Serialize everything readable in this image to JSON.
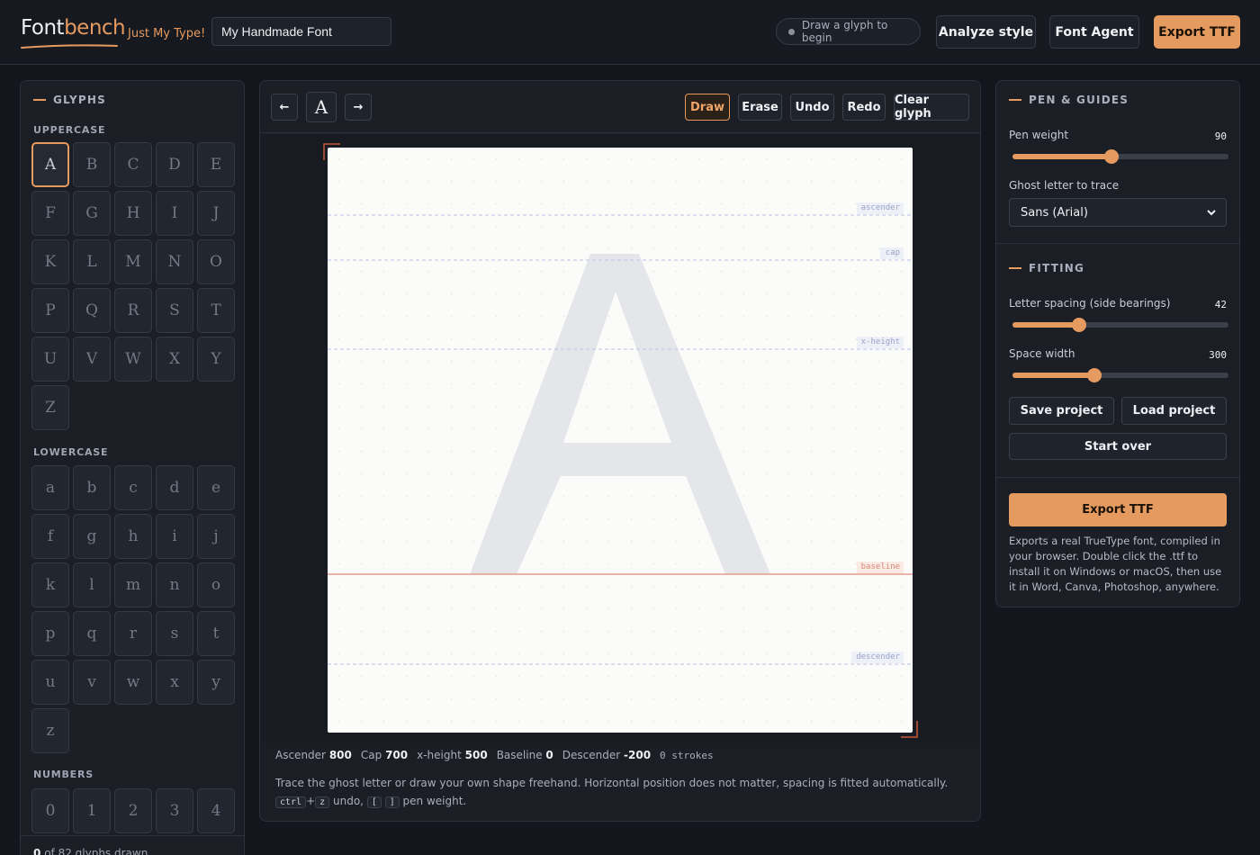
{
  "header": {
    "logo_main": "Font",
    "logo_accent": "bench",
    "tagline": "Just My Type!",
    "font_name_value": "My Handmade Font",
    "status": "Draw a glyph to begin",
    "analyze_label": "Analyze style",
    "agent_label": "Font Agent",
    "export_label": "Export TTF"
  },
  "glyphs": {
    "title": "GLYPHS",
    "uppercase_label": "UPPERCASE",
    "uppercase": [
      "A",
      "B",
      "C",
      "D",
      "E",
      "F",
      "G",
      "H",
      "I",
      "J",
      "K",
      "L",
      "M",
      "N",
      "O",
      "P",
      "Q",
      "R",
      "S",
      "T",
      "U",
      "V",
      "W",
      "X",
      "Y",
      "Z"
    ],
    "lowercase_label": "LOWERCASE",
    "lowercase": [
      "a",
      "b",
      "c",
      "d",
      "e",
      "f",
      "g",
      "h",
      "i",
      "j",
      "k",
      "l",
      "m",
      "n",
      "o",
      "p",
      "q",
      "r",
      "s",
      "t",
      "u",
      "v",
      "w",
      "x",
      "y",
      "z"
    ],
    "numbers_label": "NUMBERS",
    "numbers": [
      "0",
      "1",
      "2",
      "3",
      "4"
    ],
    "active": "A",
    "drawn_count": "0",
    "drawn_suffix": "of 82 glyphs drawn"
  },
  "canvas": {
    "prev_label": "←",
    "current_glyph": "A",
    "next_label": "→",
    "tools": [
      "Draw",
      "Erase",
      "Undo",
      "Redo",
      "Clear glyph"
    ],
    "active_tool": "Draw",
    "ghost_letter": "A",
    "guides": {
      "ascender": "ascender",
      "cap": "cap",
      "xheight": "x-height",
      "baseline": "baseline",
      "descender": "descender"
    },
    "metrics": {
      "ascender_label": "Ascender",
      "ascender": "800",
      "cap_label": "Cap",
      "cap": "700",
      "xheight_label": "x-height",
      "xheight": "500",
      "baseline_label": "Baseline",
      "baseline": "0",
      "descender_label": "Descender",
      "descender": "-200",
      "strokes": "0 strokes"
    },
    "help_text": "Trace the ghost letter or draw your own shape freehand. Horizontal position does not matter, spacing is fitted automatically.",
    "help_key1": "ctrl",
    "help_plus": "+",
    "help_key2": "z",
    "help_undo": "undo,",
    "help_key3": "[",
    "help_key4": "]",
    "help_pen": "pen weight."
  },
  "pen": {
    "title": "PEN & GUIDES",
    "weight_label": "Pen weight",
    "weight_value": "90",
    "weight_fraction": 0.46,
    "ghost_label": "Ghost letter to trace",
    "ghost_value": "Sans (Arial)"
  },
  "fitting": {
    "title": "FITTING",
    "spacing_label": "Letter spacing (side bearings)",
    "spacing_value": "42",
    "spacing_fraction": 0.31,
    "space_label": "Space width",
    "space_value": "300",
    "space_fraction": 0.38,
    "save_label": "Save project",
    "load_label": "Load project",
    "start_over_label": "Start over",
    "export_label": "Export TTF",
    "export_note": "Exports a real TrueType font, compiled in your browser. Double click the .ttf to install it on Windows or macOS, then use it in Word, Canva, Photoshop, anywhere."
  },
  "colors": {
    "accent": "#e59a5f",
    "background": "#13161c",
    "panel": "#1b1e25",
    "baseline": "#e8a99b",
    "guide": "#c6cbe6"
  }
}
